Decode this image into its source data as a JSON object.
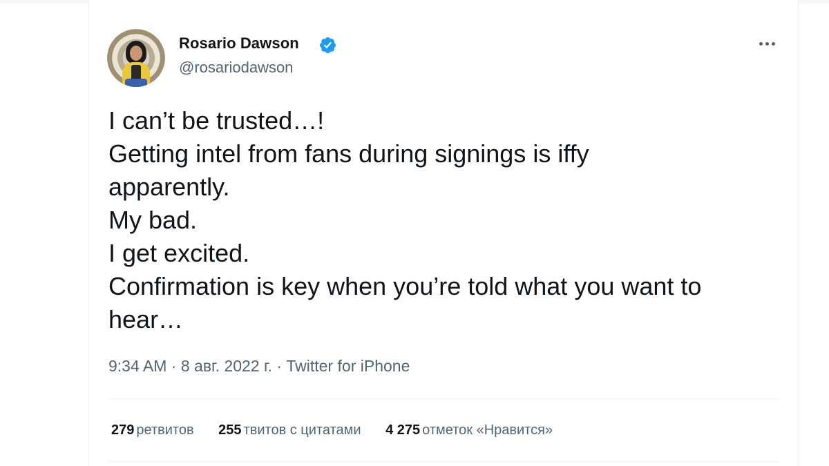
{
  "tweet": {
    "author": {
      "name": "Rosario Dawson",
      "handle": "@rosariodawson",
      "verified": true
    },
    "text_lines": [
      "I can’t be trusted…!",
      "Getting intel from fans during signings is iffy",
      "apparently.",
      "My bad.",
      "I get excited.",
      "Confirmation is key when you’re told what you want to",
      "hear…"
    ],
    "meta": {
      "time": "9:34 AM",
      "separator": " · ",
      "date": "8 авг. 2022 г.",
      "source": "Twitter for iPhone"
    },
    "stats": {
      "retweets": {
        "count": "279",
        "label": "ретвитов"
      },
      "quotes": {
        "count": "255",
        "label": "твитов с цитатами"
      },
      "likes": {
        "count": "4 275",
        "label": "отметок «Нравится»"
      }
    }
  },
  "icons": {
    "verified": "verified-badge-icon",
    "more": "more-options-icon"
  },
  "colors": {
    "text_primary": "#0f1419",
    "text_secondary": "#536471",
    "verified_blue": "#1d9bf0",
    "divider": "#eff3f4"
  }
}
